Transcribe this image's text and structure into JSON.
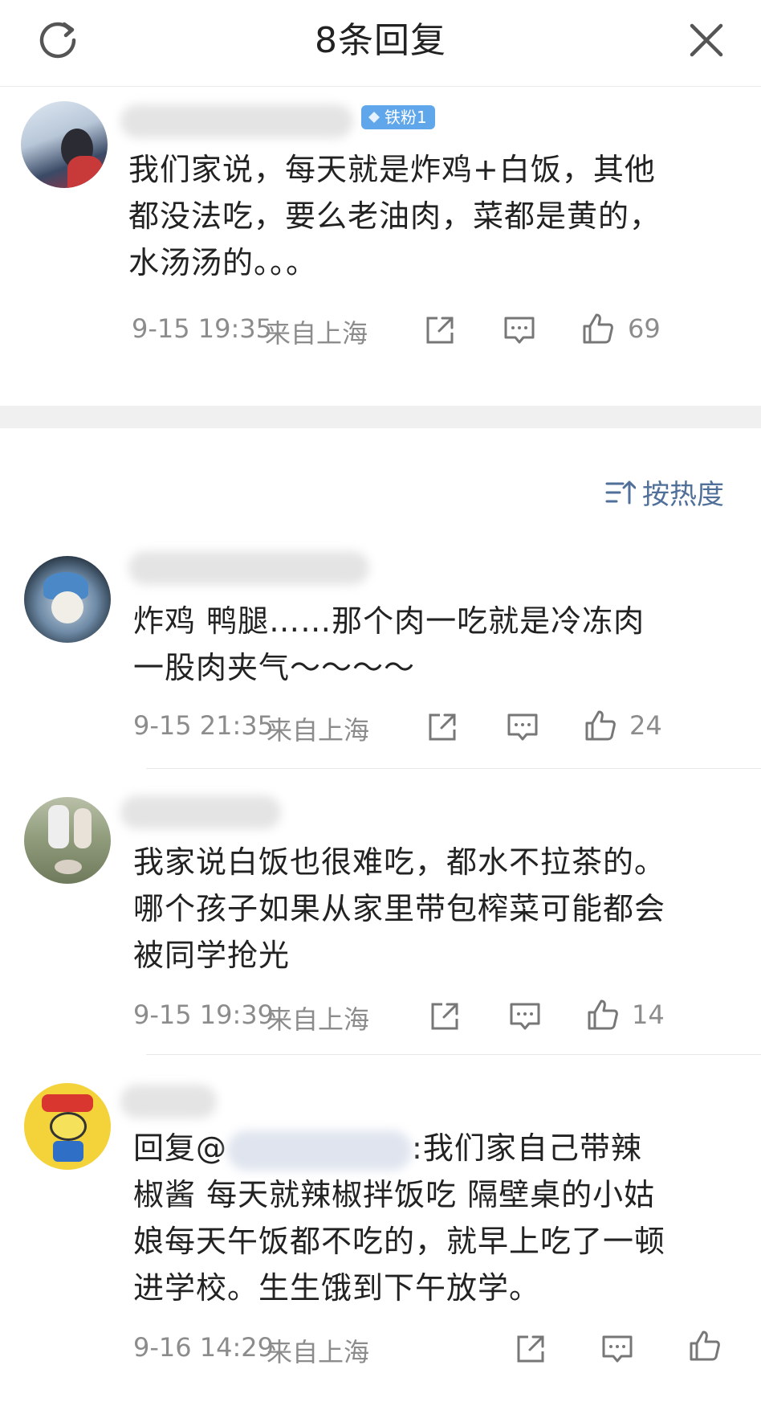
{
  "header": {
    "title": "8条回复"
  },
  "main_comment": {
    "badge": "铁粉1",
    "text": "我们家说，每天就是炸鸡+白饭，其他都没法吃，要么老油肉，菜都是黄的，水汤汤的。。。",
    "time": "9-15 19:35",
    "location": "来自上海",
    "likes": "69"
  },
  "sort": {
    "label": "按热度"
  },
  "replies": [
    {
      "text": "炸鸡 鸭腿……那个肉一吃就是冷冻肉一股肉夹气～～～～",
      "time": "9-15 21:35",
      "location": "来自上海",
      "likes": "24"
    },
    {
      "text": "我家说白饭也很难吃，都水不拉茶的。哪个孩子如果从家里带包榨菜可能都会被同学抢光",
      "time": "9-15 19:39",
      "location": "来自上海",
      "likes": "14"
    },
    {
      "reply_prefix": "回复@",
      "text": ":我们家自己带辣椒酱 每天就辣椒拌饭吃 隔壁桌的小姑娘每天午饭都不吃的，就早上吃了一顿进学校。生生饿到下午放学。",
      "time": "9-16 14:29",
      "location": "来自上海",
      "likes": ""
    }
  ],
  "icons": {
    "refresh": "refresh-icon",
    "close": "close-icon",
    "share": "share-icon",
    "comment": "comment-icon",
    "like": "thumbs-up-icon",
    "sort": "sort-icon"
  },
  "colors": {
    "badge": "#5fa7ea",
    "sort": "#50709a",
    "meta": "#8c8c8c"
  }
}
